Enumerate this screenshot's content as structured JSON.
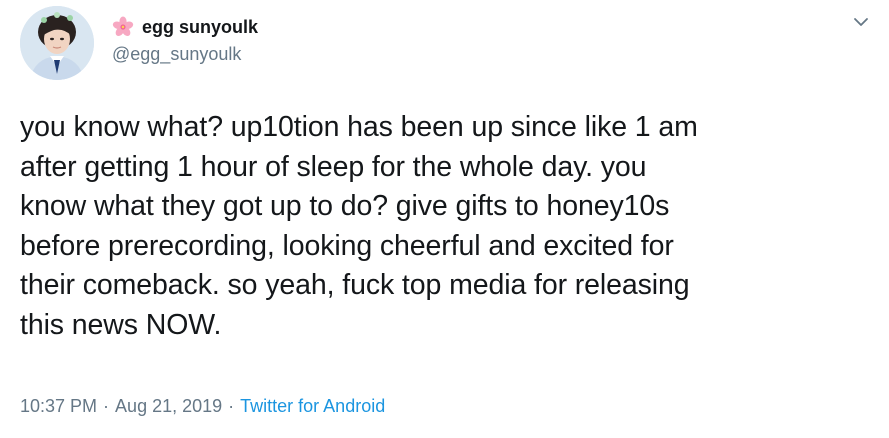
{
  "author": {
    "display_name": "egg sunyoulk",
    "handle": "@egg_sunyoulk",
    "name_emoji": "cherry-blossom-icon"
  },
  "tweet": {
    "lines": [
      "you know what? up10tion has been up since like 1 am",
      "after getting 1 hour of sleep for the whole day. you",
      "know what they got up to do? give gifts to honey10s",
      "before prerecording, looking cheerful and excited for",
      "their comeback. so yeah, fuck top media for releasing",
      "this news NOW."
    ]
  },
  "meta": {
    "time": "10:37 PM",
    "separator": "·",
    "date": "Aug 21, 2019",
    "source": "Twitter for Android"
  },
  "colors": {
    "text": "#14171a",
    "secondary": "#657786",
    "link": "#1b95e0"
  }
}
